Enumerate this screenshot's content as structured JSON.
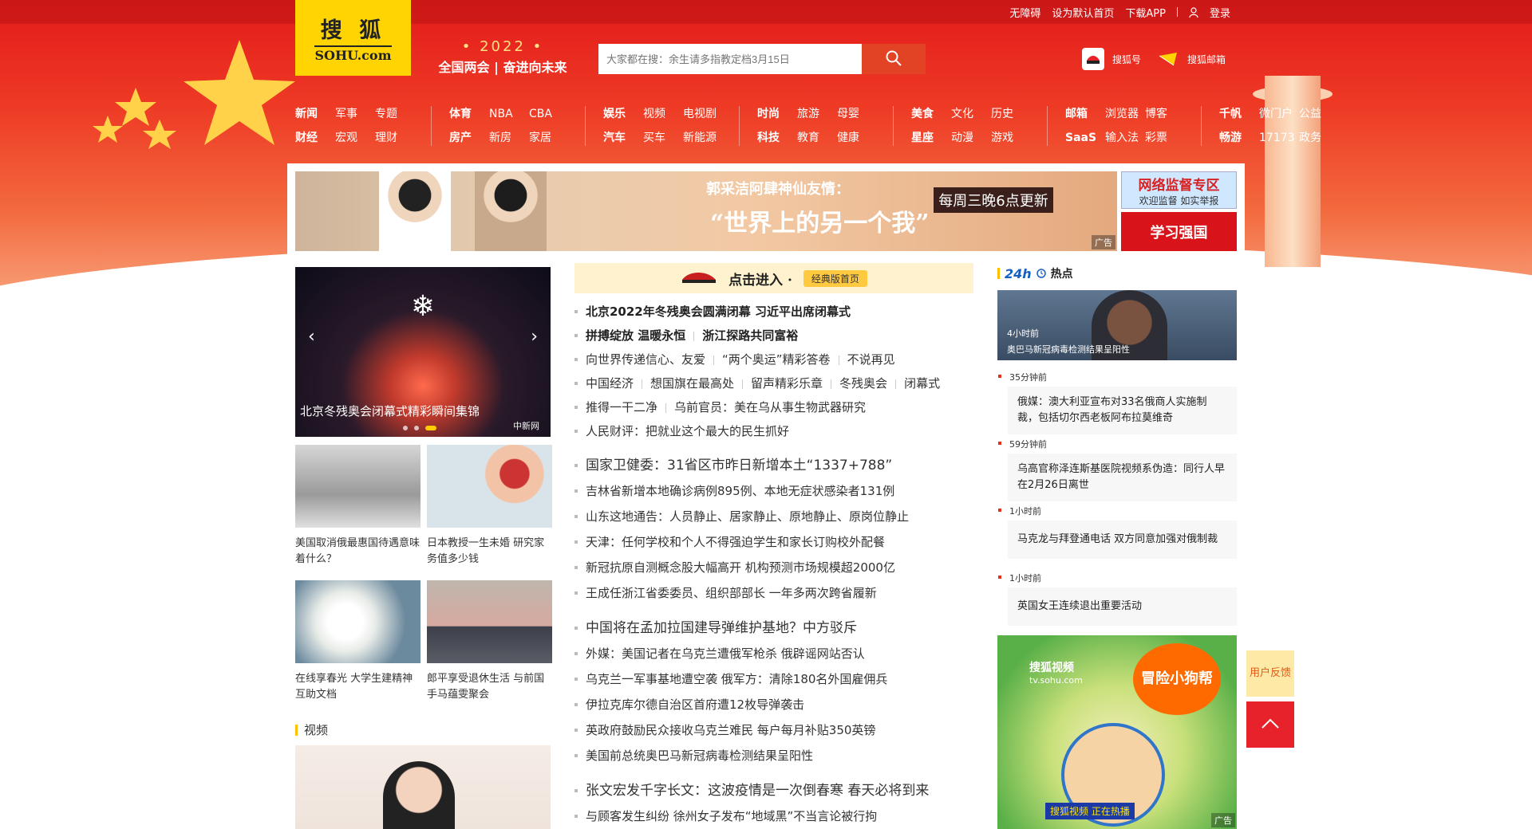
{
  "topbar": {
    "items": [
      "无障碍",
      "设为默认首页",
      "下载APP"
    ],
    "login": "登录"
  },
  "logo": {
    "cn": "搜 狐",
    "en": "SOHU.com"
  },
  "slogan": {
    "year": "• 2022 •",
    "text": "全国两会 | 奋进向未来"
  },
  "search": {
    "placeholder": "大家都在搜：余生请多指教定档3月15日"
  },
  "head_links": [
    {
      "label": "搜狐号"
    },
    {
      "label": "搜狐邮箱"
    }
  ],
  "nav": [
    [
      "新闻",
      "军事",
      "专题",
      "财经",
      "宏观",
      "理财"
    ],
    [
      "体育",
      "NBA",
      "CBA",
      "房产",
      "新房",
      "家居"
    ],
    [
      "娱乐",
      "视频",
      "电视剧",
      "汽车",
      "买车",
      "新能源"
    ],
    [
      "时尚",
      "旅游",
      "母婴",
      "科技",
      "教育",
      "健康"
    ],
    [
      "美食",
      "文化",
      "历史",
      "星座",
      "动漫",
      "游戏"
    ],
    [
      "邮箱",
      "浏览器",
      "博客",
      "SaaS",
      "输入法",
      "彩票"
    ],
    [
      "千帆",
      "微门户",
      "公益",
      "畅游",
      "17173",
      "政务"
    ]
  ],
  "banner": {
    "line1": "郭采洁阿肆神仙友情：",
    "line2": "“世界上的另一个我”",
    "update": "每周三晚6点更新",
    "ad": "广告"
  },
  "side_ad1": {
    "a": "网络监督专区",
    "b": "欢迎监督 如实举报"
  },
  "side_ad2": {
    "text": "学习强国"
  },
  "slide": {
    "caption": "北京冬残奥会闭幕式精彩瞬间集锦",
    "source": "中新网"
  },
  "thumbs": [
    {
      "title": "美国取消俄最惠国待遇意味着什么？"
    },
    {
      "title": "日本教授一生未婚 研究家务值多少钱"
    },
    {
      "title": "在线享春光 大学生建精神互助文档"
    },
    {
      "title": "郎平享受退休生活 与前国手马蕴雯聚会"
    }
  ],
  "video_section": {
    "title": "视频"
  },
  "clickin": {
    "text": "点击进入 ·",
    "pill": "经典版首页"
  },
  "news": {
    "g1": [
      [
        "北京2022年冬残奥会圆满闭幕 习近平出席闭幕式"
      ],
      [
        "拼搏绽放 温暖永恒",
        "浙江探路共同富裕"
      ],
      [
        "向世界传递信心、友爱",
        "“两个奥运”精彩答卷",
        "不说再见"
      ],
      [
        "中国经济",
        "想国旗在最高处",
        "留声精彩乐章",
        "冬残奥会",
        "闭幕式"
      ],
      [
        "推得一干二净",
        "乌前官员：美在乌从事生物武器研究"
      ],
      [
        "人民财评：把就业这个最大的民生抓好"
      ]
    ],
    "g2": [
      "国家卫健委：31省区市昨日新增本土“1337+788”",
      "吉林省新增本地确诊病例895例、本地无症状感染者131例",
      "山东这地通告：人员静止、居家静止、原地静止、原岗位静止",
      "天津：任何学校和个人不得强迫学生和家长订购校外配餐",
      "新冠抗原自测概念股大幅高开 机构预测市场规模超2000亿",
      "王成任浙江省委委员、组织部部长 一年多两次跨省履新"
    ],
    "g3": [
      "中国将在孟加拉国建导弹维护基地？中方驳斥",
      "外媒：美国记者在乌克兰遭俄军枪杀 俄辟谣网站否认",
      "乌克兰一军事基地遭空袭 俄军方：清除180名外国雇佣兵",
      "伊拉克库尔德自治区首府遭12枚导弹袭击",
      "英政府鼓励民众接收乌克兰难民 每户每月补贴350英镑",
      "美国前总统奥巴马新冠病毒检测结果呈阳性"
    ],
    "g4": [
      "张文宏发千字长文：这波疫情是一次倒春寒 春天必将到来",
      "与顾客发生纠纷 徐州女子发布“地域黑”不当言论被行拘"
    ]
  },
  "hot": {
    "header_a": "24h",
    "header_b": "热点",
    "top": {
      "time": "4小时前",
      "title": "奥巴马新冠病毒检测结果呈阳性"
    },
    "items": [
      {
        "time": "35分钟前",
        "title": "俄媒：澳大利亚宣布对33名俄商人实施制裁，包括切尔西老板阿布拉莫维奇"
      },
      {
        "time": "59分钟前",
        "title": "乌高官称泽连斯基医院视频系伪造：同行人早在2月26日离世"
      },
      {
        "time": "1小时前",
        "title": "马克龙与拜登通电话 双方同意加强对俄制裁"
      },
      {
        "time": "1小时前",
        "title": "英国女王连续退出重要活动"
      }
    ]
  },
  "rt_ad": {
    "brand": "搜狐视频",
    "brand2": "tv.sohu.com",
    "title": "冒险小狗帮",
    "tag": "搜狐视频 正在热播",
    "ad": "广告"
  },
  "feedback": {
    "text": "用户反馈"
  },
  "colors": {
    "accent": "#e8222a",
    "brand": "#ffd400"
  }
}
